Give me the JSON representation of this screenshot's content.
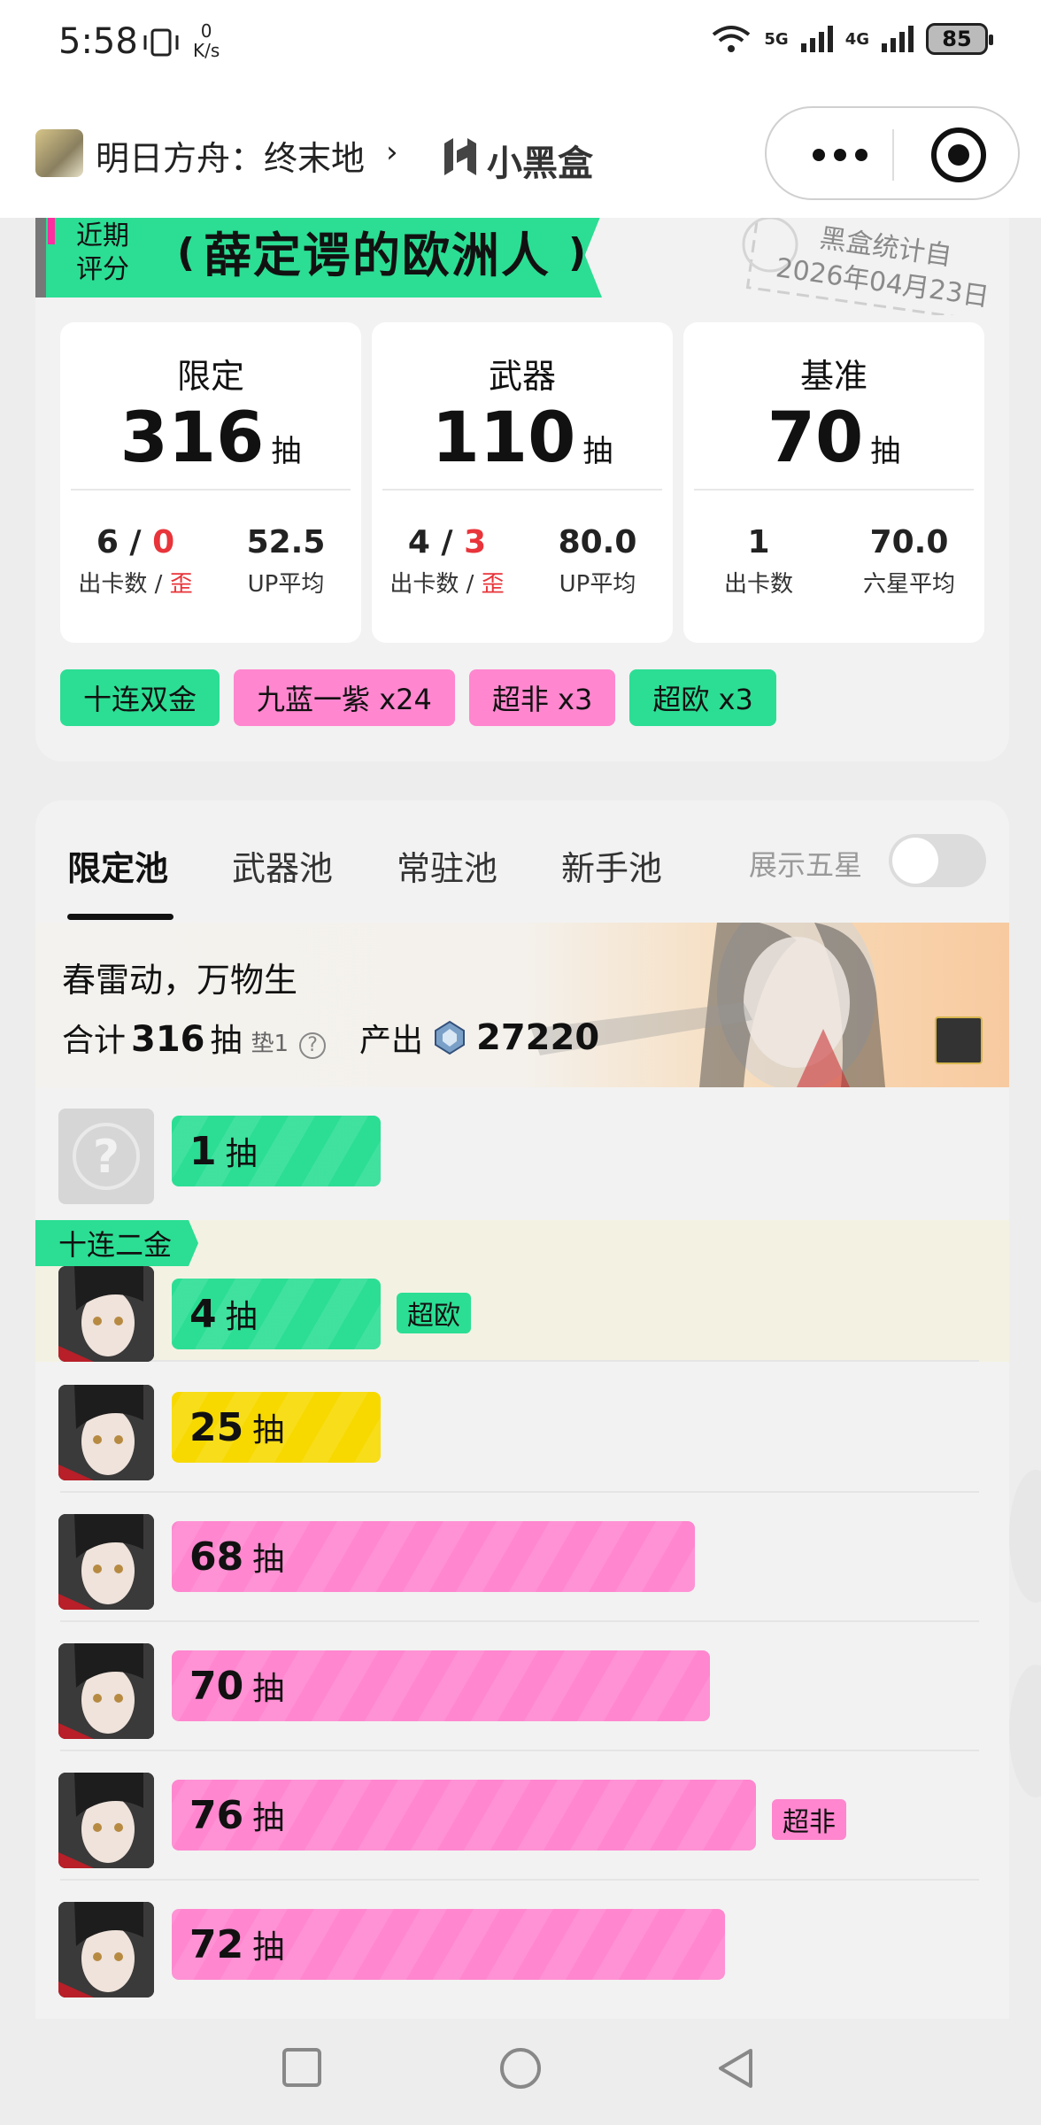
{
  "status_bar": {
    "time": "5:58",
    "speed_value": "0",
    "speed_unit": "K/s",
    "net1": "5G",
    "net2": "4G",
    "battery": "85"
  },
  "app_header": {
    "title": "明日方舟：终末地",
    "brand": "小黑盒"
  },
  "score": {
    "label_line1": "近期",
    "label_line2": "评分",
    "title": "薛定谔的欧洲人",
    "stamp_line1": "黑盒统计自",
    "stamp_line2": "2026年04月23日"
  },
  "stats": [
    {
      "name": "限定",
      "total": "316",
      "unit": "抽",
      "left_value": "6",
      "left_slash": "/",
      "left_value_red": "0",
      "left_label": "出卡数 / ",
      "left_label_red": "歪",
      "right_value": "52.5",
      "right_label": "UP平均"
    },
    {
      "name": "武器",
      "total": "110",
      "unit": "抽",
      "left_value": "4",
      "left_slash": "/",
      "left_value_red": "3",
      "left_label": "出卡数 / ",
      "left_label_red": "歪",
      "right_value": "80.0",
      "right_label": "UP平均"
    },
    {
      "name": "基准",
      "total": "70",
      "unit": "抽",
      "left_value": "1",
      "left_slash": "",
      "left_value_red": "",
      "left_label": "出卡数",
      "left_label_red": "",
      "right_value": "70.0",
      "right_label": "六星平均"
    }
  ],
  "tags": [
    {
      "label": "十连双金",
      "color": "#2bde94"
    },
    {
      "label": "九蓝一紫 x24",
      "color": "#ff86cf"
    },
    {
      "label": "超非 x3",
      "color": "#ff86cf"
    },
    {
      "label": "超欧 x3",
      "color": "#2bde94"
    }
  ],
  "tabs": [
    "限定池",
    "武器池",
    "常驻池",
    "新手池"
  ],
  "toggle_label": "展示五星",
  "pool": {
    "name": "春雷动，万物生",
    "total_prefix": "合计",
    "total": "316",
    "unit": "抽",
    "pad": "垫1",
    "output_label": "产出",
    "output_value": "27220"
  },
  "group_label": "十连二金",
  "pulls": [
    {
      "count": "1",
      "unit": "抽",
      "color": "green",
      "badge": "",
      "fill": 1
    },
    {
      "count": "4",
      "unit": "抽",
      "color": "green",
      "badge": "超欧",
      "fill": 4
    },
    {
      "count": "25",
      "unit": "抽",
      "color": "yellow",
      "badge": "",
      "fill": 25
    },
    {
      "count": "68",
      "unit": "抽",
      "color": "pink",
      "badge": "",
      "fill": 68
    },
    {
      "count": "70",
      "unit": "抽",
      "color": "pink",
      "badge": "",
      "fill": 70
    },
    {
      "count": "76",
      "unit": "抽",
      "color": "pink",
      "badge": "超非",
      "fill": 76
    },
    {
      "count": "72",
      "unit": "抽",
      "color": "pink",
      "badge": "",
      "fill": 72
    }
  ],
  "colors": {
    "green": "#2bde94",
    "pink": "#ff86cf",
    "yellow": "#f7d900",
    "red": "#e8343a"
  }
}
